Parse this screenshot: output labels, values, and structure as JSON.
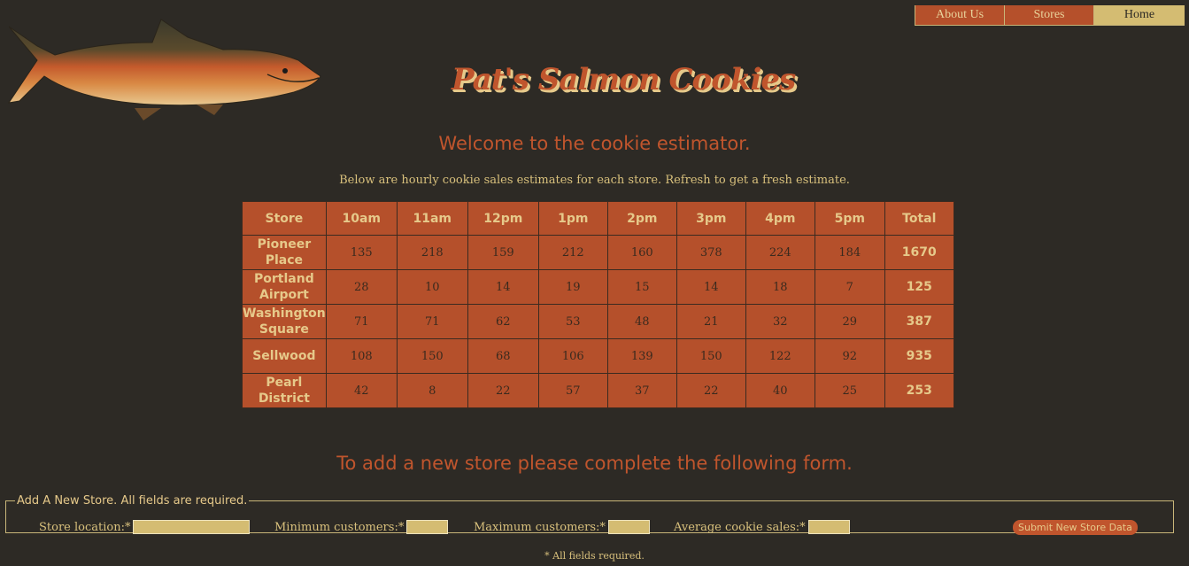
{
  "nav": {
    "items": [
      {
        "label": "About Us"
      },
      {
        "label": "Stores"
      },
      {
        "label": "Home"
      }
    ]
  },
  "header": {
    "logo_text": "Pat's Salmon Cookies"
  },
  "main": {
    "welcome": "Welcome to the cookie estimator.",
    "subtitle": "Below are hourly cookie sales estimates for each store. Refresh to get a fresh estimate."
  },
  "table": {
    "headers": [
      "Store",
      "10am",
      "11am",
      "12pm",
      "1pm",
      "2pm",
      "3pm",
      "4pm",
      "5pm",
      "Total"
    ],
    "rows": [
      {
        "store": "Pioneer Place",
        "hours": [
          "135",
          "218",
          "159",
          "212",
          "160",
          "378",
          "224",
          "184"
        ],
        "total": "1670"
      },
      {
        "store": "Portland Airport",
        "hours": [
          "28",
          "10",
          "14",
          "19",
          "15",
          "14",
          "18",
          "7"
        ],
        "total": "125"
      },
      {
        "store": "Washington Square",
        "hours": [
          "71",
          "71",
          "62",
          "53",
          "48",
          "21",
          "32",
          "29"
        ],
        "total": "387"
      },
      {
        "store": "Sellwood",
        "hours": [
          "108",
          "150",
          "68",
          "106",
          "139",
          "150",
          "122",
          "92"
        ],
        "total": "935"
      },
      {
        "store": "Pearl District",
        "hours": [
          "42",
          "8",
          "22",
          "57",
          "37",
          "22",
          "40",
          "25"
        ],
        "total": "253"
      }
    ]
  },
  "form": {
    "heading": "To add a new store please complete the following form.",
    "legend": "Add A New Store. All fields are required.",
    "location_label": "Store location:*",
    "min_label": "Minimum customers:*",
    "max_label": "Maximum customers:*",
    "avg_label": "Average cookie sales:*",
    "location_value": "",
    "min_value": "",
    "max_value": "",
    "avg_value": "",
    "submit_label": "Submit New Store Data",
    "footnote": "* All fields required."
  },
  "colors": {
    "background": "#2d2a25",
    "accent": "#b5502b",
    "gold": "#d4bc72"
  }
}
